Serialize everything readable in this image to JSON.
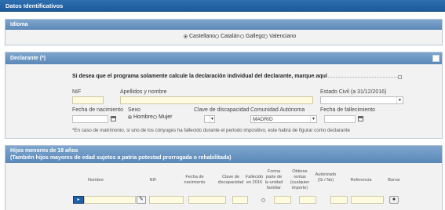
{
  "header": {
    "title": "Datos Identificativos"
  },
  "idioma": {
    "title": "Idioma",
    "options": [
      "Castellano",
      "Catalán",
      "Gallego",
      "Valenciano"
    ],
    "selected": "Castellano"
  },
  "declarante": {
    "title": "Declarante (*)",
    "individual_note": "Si desea que el programa solamente calcule la declaración individual del declarante, marque aquí",
    "nif_label": "NIF",
    "apellidos_label": "Apellidos y nombre",
    "estado_civil_label": "Estado Civil (a 31/12/2016)",
    "fecha_nac_label": "Fecha de nacimiento",
    "sexo_label": "Sexo",
    "sexo_options": [
      "Hombre",
      "Mujer"
    ],
    "sexo_selected": "Hombre",
    "clave_disc_label": "Clave de discapacidad",
    "comunidad_label": "Comunidad Autónoma",
    "comunidad_value": "MADRID",
    "fecha_fall_label": "Fecha de fallecimiento",
    "footnote": "*En caso de matrimonio, si uno de los cónyuges ha fallecido durante el periodo impositivo, este habrá de figurar como declarante"
  },
  "hijos": {
    "title_line1": "Hijos menores de 18 años",
    "title_line2": "(También hijos mayores de edad sujetos a patria potestad prorrogada o rehabilitada)",
    "columns": {
      "nombre": "Nombre",
      "nif": "NIF",
      "fecha_nac": "Fecha de nacimiento",
      "clave_disc": "Clave de discapacidad",
      "fallecido": "Fallecido en 2016",
      "forma_parte": "Forma parte de la unidad familiar",
      "obtiene_rentas": "Obtiene rentas (cualquier importe)",
      "autorizado": "Autorizado (Si / No)",
      "referencia": "Referencia",
      "borrar": "Borrar"
    }
  }
}
